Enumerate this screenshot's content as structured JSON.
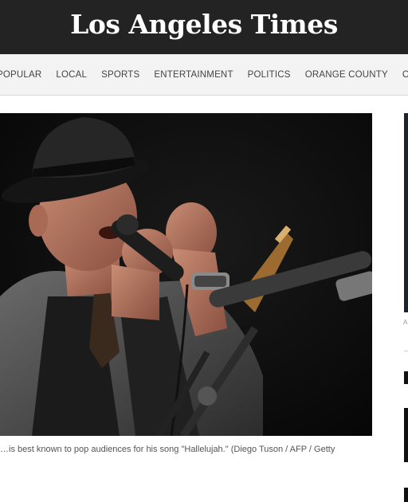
{
  "masthead": {
    "logo_text": "Los Angeles Times"
  },
  "nav": {
    "items": [
      "Popular",
      "Local",
      "Sports",
      "Entertainment",
      "Politics",
      "Orange County",
      "Opinion"
    ]
  },
  "article": {
    "photo_alt": "Performer in a black fedora singing into a microphone on stage",
    "caption": "…is best known to pop audiences for his song \"Hallelujah.\" (Diego Tuson / AFP / Getty"
  },
  "right_rail": {
    "ad_label": "A"
  }
}
